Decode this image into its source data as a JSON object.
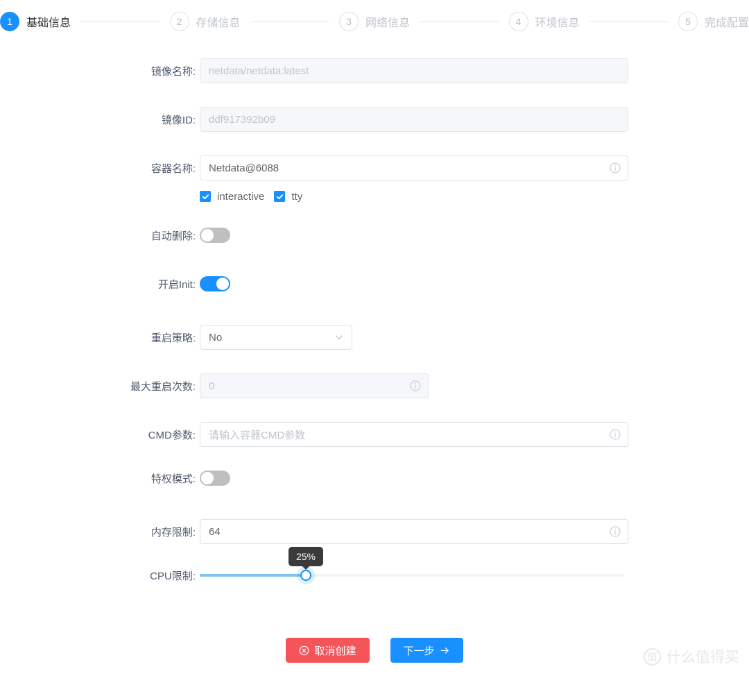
{
  "stepper": {
    "steps": [
      {
        "num": "1",
        "label": "基础信息",
        "state": "active"
      },
      {
        "num": "2",
        "label": "存储信息",
        "state": "idle"
      },
      {
        "num": "3",
        "label": "网络信息",
        "state": "idle"
      },
      {
        "num": "4",
        "label": "环境信息",
        "state": "idle"
      },
      {
        "num": "5",
        "label": "完成配置",
        "state": "idle"
      }
    ]
  },
  "form": {
    "image_name": {
      "label": "镜像名称:",
      "value": "netdata/netdata:latest",
      "disabled": true
    },
    "image_id": {
      "label": "镜像ID:",
      "value": "ddf917392b09",
      "disabled": true
    },
    "container_name": {
      "label": "容器名称:",
      "value": "Netdata@6088",
      "info": "info-icon"
    },
    "checkboxes": [
      {
        "label": "interactive",
        "checked": true
      },
      {
        "label": "tty",
        "checked": true
      }
    ],
    "auto_remove": {
      "label": "自动删除:",
      "on": false
    },
    "init": {
      "label": "开启Init:",
      "on": true
    },
    "restart_policy": {
      "label": "重启策略:",
      "value": "No",
      "options": [
        "No"
      ]
    },
    "max_restart": {
      "label": "最大重启次数:",
      "value": "0",
      "disabled": true,
      "info": "info-icon"
    },
    "cmd_args": {
      "label": "CMD参数:",
      "placeholder": "请输入容器CMD参数",
      "value": "",
      "info": "info-icon"
    },
    "privileged": {
      "label": "特权模式:",
      "on": false
    },
    "memory_limit": {
      "label": "内存限制:",
      "value": "64",
      "info": "info-icon"
    },
    "cpu_limit": {
      "label": "CPU限制:",
      "percent": 25,
      "tooltip": "25%",
      "min": 0,
      "max": 100
    }
  },
  "actions": {
    "cancel": {
      "label": "取消创建",
      "icon": "cancel-circle-icon",
      "color": "#f5555a"
    },
    "next": {
      "label": "下一步",
      "icon": "arrow-right-icon",
      "color": "#1890ff"
    }
  },
  "watermark": {
    "mark": "值",
    "text": "什么值得买"
  }
}
